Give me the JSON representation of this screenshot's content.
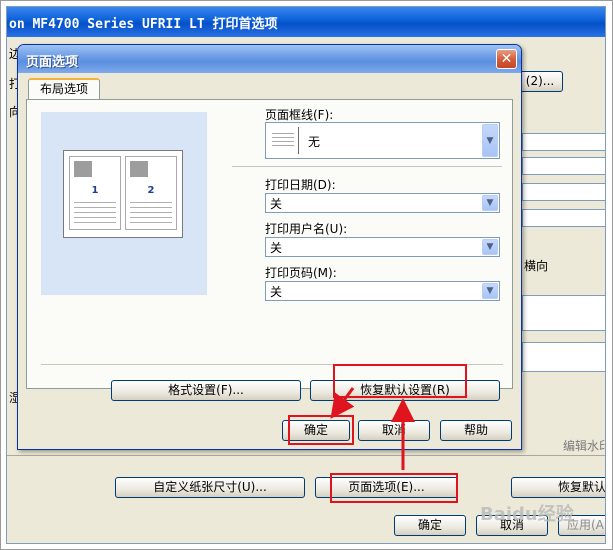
{
  "bg_window": {
    "title": "on MF4700 Series UFRII LT 打印首选项",
    "top_button": "(2)...",
    "left_clips": [
      "边",
      "打",
      "向",
      "湿"
    ],
    "right_label": "横向",
    "right_clipped": "编辑水印",
    "buttons": {
      "custom_paper": "自定义纸张尺寸(U)...",
      "page_options": "页面选项(E)...",
      "restore": "恢复默认",
      "ok": "确定",
      "cancel": "取消",
      "apply": "应用(A)"
    }
  },
  "dialog": {
    "title": "页面选项",
    "close_glyph": "✕",
    "tab": "布局选项",
    "preview_pages": [
      "1",
      "2"
    ],
    "fields": {
      "border": {
        "label": "页面框线(F):",
        "value": "无"
      },
      "date": {
        "label": "打印日期(D):",
        "value": "关"
      },
      "user": {
        "label": "打印用户名(U):",
        "value": "关"
      },
      "page_num": {
        "label": "打印页码(M):",
        "value": "关"
      }
    },
    "buttons": {
      "format": "格式设置(F)...",
      "restore": "恢复默认设置(R)",
      "ok": "确定",
      "cancel": "取消",
      "help": "帮助"
    }
  },
  "watermark": "Baidu经验",
  "colors": {
    "annotation": "#e0141e",
    "dialog_titlebar": "#6f9ee6",
    "bg_titlebar": "#0a5fd6"
  }
}
